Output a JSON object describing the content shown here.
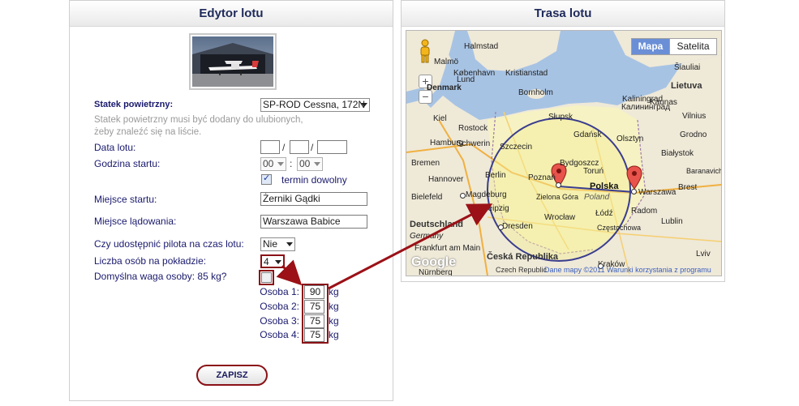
{
  "editor": {
    "title": "Edytor lotu",
    "aircraft_label": "Statek powietrzny:",
    "aircraft_value": "SP-ROD Cessna, 172N",
    "aircraft_hint": "Statek powietrzny musi być dodany do ulubionych, żeby znaleźć się na liście.",
    "date_label": "Data lotu:",
    "date_sep": "/",
    "start_time_label": "Godzina startu:",
    "hour_value": "00",
    "minute_value": "00",
    "time_sep": ":",
    "flexible_label": "termin dowolny",
    "departure_label": "Miejsce startu:",
    "departure_value": "Żerniki Gądki",
    "arrival_label": "Miejsce lądowania:",
    "arrival_value": "Warszawa Babice",
    "share_pilot_label": "Czy udostępnić pilota na czas lotu:",
    "share_pilot_value": "Nie",
    "persons_label": "Liczba osób na pokładzie:",
    "persons_value": "4",
    "default_weight_label": "Domyślna waga osoby: 85 kg?",
    "persons": [
      {
        "label": "Osoba 1:",
        "weight": "90",
        "unit": "kg"
      },
      {
        "label": "Osoba 2:",
        "weight": "75",
        "unit": "kg"
      },
      {
        "label": "Osoba 3:",
        "weight": "75",
        "unit": "kg"
      },
      {
        "label": "Osoba 4:",
        "weight": "75",
        "unit": "kg"
      }
    ],
    "save_label": "ZAPISZ"
  },
  "route": {
    "title": "Trasa lotu",
    "map_tab": "Mapa",
    "satellite_tab": "Satelita",
    "zoom_in": "+",
    "zoom_out": "−",
    "google": "Google",
    "legal_left": "Czech Republic",
    "legal_right": "Dane mapy ©2011 Warunki korzystania z programu",
    "cities": {
      "kobenhavn": "København",
      "kristianstad": "Kristianstad",
      "bornholm": "Bornholm",
      "stupsk": "Słupsk",
      "gdansk": "Gdańsk",
      "kaliningrad": "Калининград",
      "kaliningrad2": "Kaliningrad",
      "rostock": "Rostock",
      "kiel": "Kiel",
      "hamburg": "Hamburg",
      "schwerin": "Schwerin",
      "szczecin": "Szczecin",
      "bydgoszcz": "Bydgoszcz",
      "torun": "Toruń",
      "olsztyn": "Olsztyn",
      "bremen": "Bremen",
      "hannover": "Hannover",
      "berlin": "Berlin",
      "poznan": "Poznań",
      "polska": "Polska",
      "poland": "Poland",
      "warszawa": "Warszawa",
      "bielefeld": "Bielefeld",
      "magdeburg": "Magdeburg",
      "leipzig": "Leipzig",
      "zielona": "Zielona Góra",
      "lodz": "Łódź",
      "deutschland": "Deutschland",
      "dresden": "Dresden",
      "wroclaw": "Wrocław",
      "radom": "Radom",
      "czestochowa": "Częstochowa",
      "germany": "Germany",
      "frankfurt": "Frankfurt am Main",
      "ceska": "Česká Republika",
      "krakow": "Kraków",
      "nurnberg": "Nürnberg",
      "lietuva": "Lietuva",
      "vilnius": "Vilnius",
      "siauliai": "Šiauliai",
      "kaunas": "Kaunas",
      "grodno": "Grodno",
      "bialystok": "Białystok",
      "baranavichy": "Baranavichy",
      "brest": "Brest",
      "lublin": "Lublin",
      "lviv": "Lviv",
      "mark": "Denmark",
      "halmstad": "Halmstad",
      "malmo": "Malmö",
      "lund": "Lund"
    }
  }
}
